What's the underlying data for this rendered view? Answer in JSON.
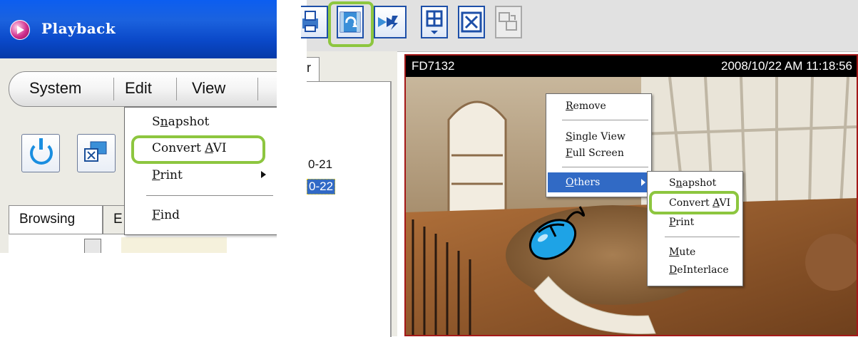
{
  "left_window": {
    "title": "Playback",
    "menubar": [
      "System",
      "Edit",
      "View"
    ],
    "tabs": [
      "Browsing",
      "E"
    ],
    "dropdown": {
      "items": [
        {
          "label": "Snapshot",
          "mnemonic": "n"
        },
        {
          "label": "Convert AVI",
          "mnemonic": "A",
          "highlighted": true
        },
        {
          "label": "Print",
          "mnemonic": "P",
          "submenu": true
        },
        {
          "label": "Find",
          "mnemonic": "F"
        }
      ]
    }
  },
  "right_toolbar": {
    "buttons": [
      {
        "icon": "printer-icon"
      },
      {
        "icon": "convert-avi-icon",
        "highlighted": true
      },
      {
        "icon": "fast-forward-icon"
      },
      {
        "icon": "layout-grid-icon"
      },
      {
        "icon": "fullscreen-icon"
      },
      {
        "icon": "remote-display-icon",
        "disabled": true
      }
    ]
  },
  "list_panel": {
    "tab_label": "r",
    "rows": [
      {
        "label": "0-21",
        "selected": false
      },
      {
        "label": "0-22",
        "selected": true
      }
    ]
  },
  "camera": {
    "name": "FD7132",
    "timestamp": "2008/10/22 AM 11:18:56"
  },
  "context_menu": {
    "items": [
      "Remove",
      "Single View",
      "Full Screen",
      "Others"
    ],
    "highlighted": "Others"
  },
  "submenu": {
    "items": [
      "Snapshot",
      "Convert AVI",
      "Print",
      "Mute",
      "DeInterlace"
    ],
    "highlighted": "Convert AVI"
  },
  "colors": {
    "highlight_ring": "#8dc63f",
    "menu_selection": "#316ac5",
    "camera_border": "#a41818",
    "xp_titlebar": "#0c5ef0"
  }
}
